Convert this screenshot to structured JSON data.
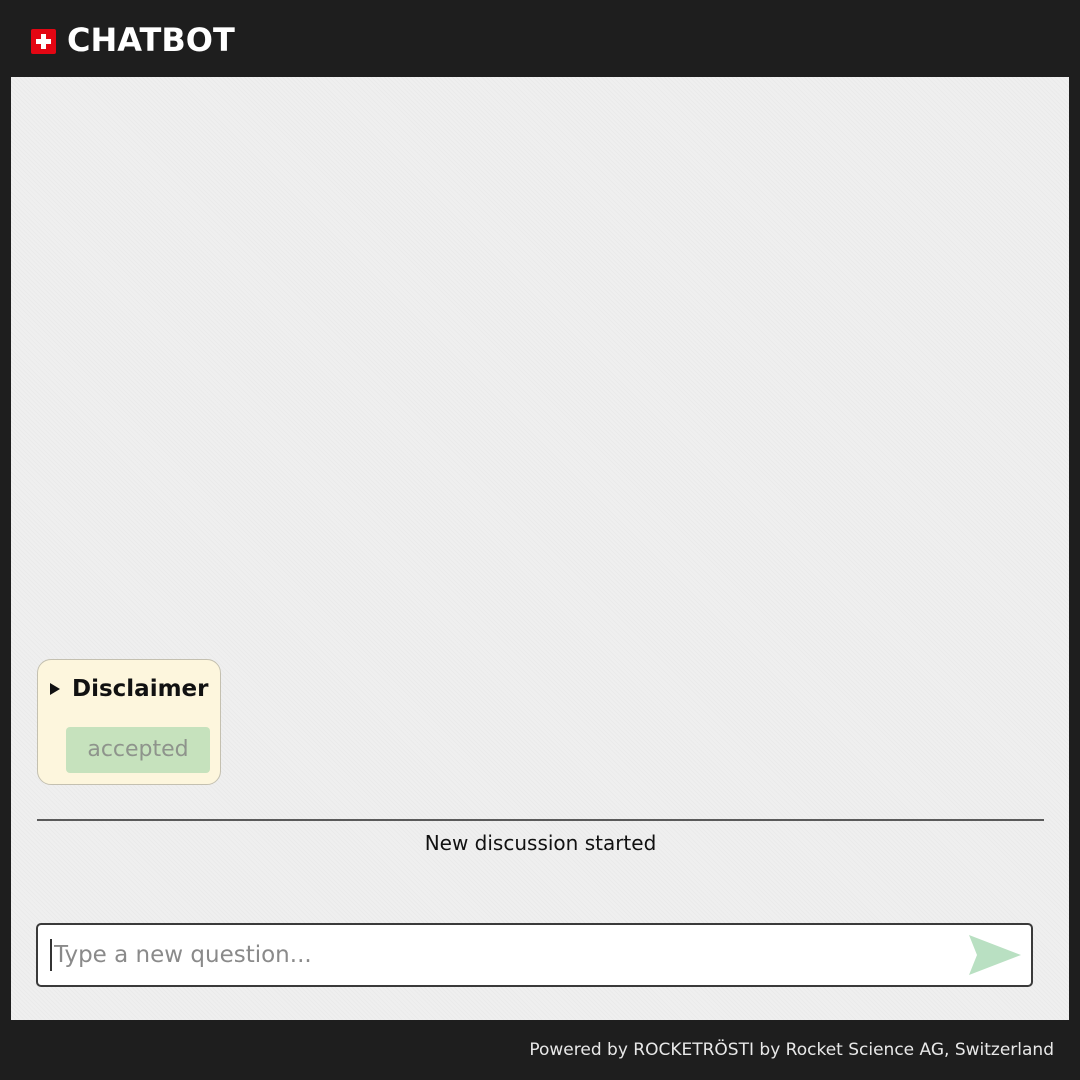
{
  "header": {
    "logo_icon": "swiss-flag-icon",
    "title": "CHATBOT"
  },
  "disclaimer": {
    "toggle_icon": "triangle-right-icon",
    "label": "Disclaimer",
    "accept_button_label": "accepted",
    "accept_button_color": "#c6e2bd"
  },
  "conversation": {
    "status": "New discussion started"
  },
  "composer": {
    "input_value": "",
    "placeholder": "Type a new question...",
    "send_icon": "send-arrow-icon",
    "send_icon_color": "#b9e0c2"
  },
  "footer": {
    "text": "Powered by ROCKETRÖSTI by Rocket Science AG, Switzerland"
  },
  "colors": {
    "header_bg": "#1e1e1e",
    "content_bg": "#efefef",
    "flag_red": "#e30613",
    "card_bg": "#fdf6dd"
  }
}
